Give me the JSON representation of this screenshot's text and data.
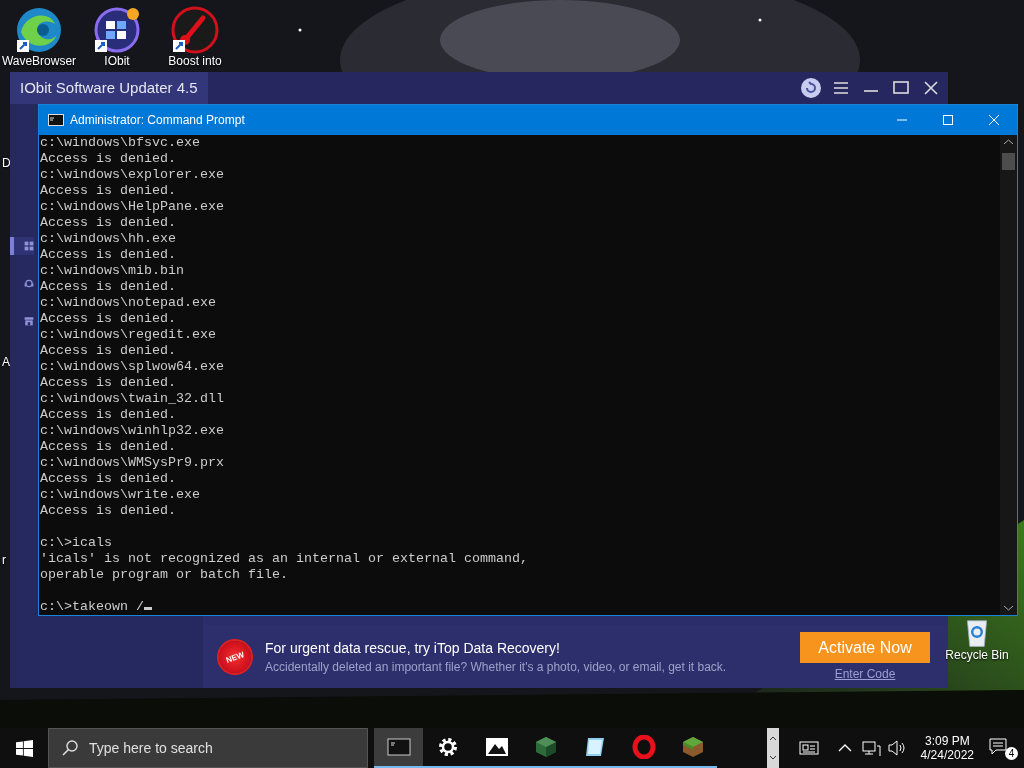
{
  "desktop": {
    "icons": [
      {
        "label": "WaveBrowser",
        "kind": "wave"
      },
      {
        "label": "IObit",
        "kind": "iobit"
      },
      {
        "label": "Boost into",
        "kind": "boost"
      }
    ],
    "edge_labels": [
      "D",
      "A",
      "r"
    ],
    "recycle_bin": {
      "label": "Recycle Bin"
    }
  },
  "updater_window": {
    "title": "IObit Software Updater 4.5",
    "sidebar": [
      {
        "kind": "grid",
        "selected": true
      },
      {
        "kind": "support",
        "selected": false
      },
      {
        "kind": "store",
        "selected": false
      }
    ],
    "promo": {
      "badge": "NEW",
      "heading": "For urgent data rescue, try iTop Data Recovery!",
      "text": "Accidentally deleted an important file? Whether it's a photo, video, or email, get it back.",
      "button": "Activate Now",
      "link": "Enter Code"
    }
  },
  "cmd_window": {
    "title": "Administrator: Command Prompt",
    "blocks": [
      [
        "c:\\windows\\bfsvc.exe",
        "Access is denied.",
        "c:\\windows\\explorer.exe",
        "Access is denied.",
        "c:\\windows\\HelpPane.exe",
        "Access is denied.",
        "c:\\windows\\hh.exe",
        "Access is denied.",
        "c:\\windows\\mib.bin",
        "Access is denied.",
        "c:\\windows\\notepad.exe",
        "Access is denied.",
        "c:\\windows\\regedit.exe",
        "Access is denied.",
        "c:\\windows\\splwow64.exe",
        "Access is denied.",
        "c:\\windows\\twain_32.dll",
        "Access is denied.",
        "c:\\windows\\winhlp32.exe",
        "Access is denied.",
        "c:\\windows\\WMSysPr9.prx",
        "Access is denied.",
        "c:\\windows\\write.exe",
        "Access is denied."
      ],
      [
        "c:\\>icals",
        "'icals' is not recognized as an internal or external command,",
        "operable program or batch file."
      ]
    ],
    "prompt": "c:\\>takeown /"
  },
  "taskbar": {
    "search_placeholder": "Type here to search",
    "apps": [
      {
        "kind": "terminal",
        "selected": true
      },
      {
        "kind": "gear",
        "selected": false
      },
      {
        "kind": "mountain",
        "selected": false
      },
      {
        "kind": "cube",
        "selected": false
      },
      {
        "kind": "notepad",
        "selected": false
      },
      {
        "kind": "ring",
        "selected": false
      },
      {
        "kind": "grass",
        "selected": false
      }
    ],
    "time": "3:09 PM",
    "date": "4/24/2022",
    "notification_count": "4"
  }
}
